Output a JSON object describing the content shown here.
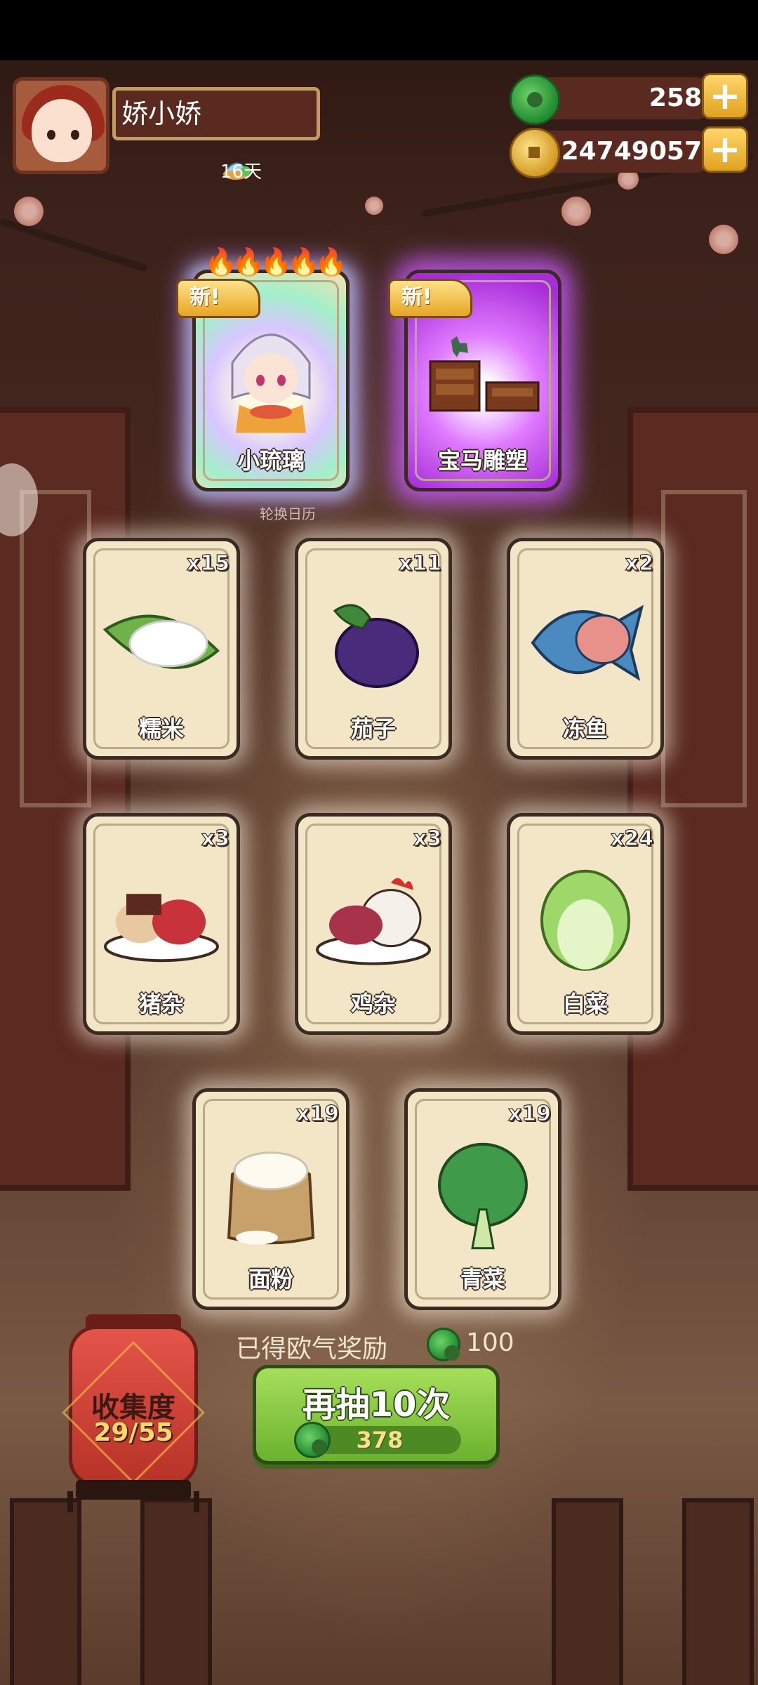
{
  "player": {
    "name": "娇小娇",
    "days": "16天"
  },
  "currency": {
    "jade": "258",
    "coins": "24749057"
  },
  "featured": [
    {
      "badge": "新",
      "label": "小琉璃",
      "stars": "🔥🔥🔥🔥🔥"
    },
    {
      "badge": "新",
      "label": "宝马雕塑"
    }
  ],
  "calendar_hint": "轮换日历",
  "items": [
    {
      "label": "糯米",
      "count": "x15"
    },
    {
      "label": "茄子",
      "count": "x11"
    },
    {
      "label": "冻鱼",
      "count": "x2"
    },
    {
      "label": "猪杂",
      "count": "x3"
    },
    {
      "label": "鸡杂",
      "count": "x3"
    },
    {
      "label": "白菜",
      "count": "x24"
    },
    {
      "label": "面粉",
      "count": "x19"
    },
    {
      "label": "青菜",
      "count": "x19"
    }
  ],
  "collection": {
    "title": "收集度",
    "value": "29/55"
  },
  "reward": {
    "text": "已得欧气奖励",
    "value": "100"
  },
  "draw_button": {
    "label": "再抽10次",
    "cost": "378"
  },
  "colors": {
    "accent_gold": "#e0a21f",
    "jade_green": "#1f8a2e",
    "button_green": "#6bb22e",
    "lantern_red": "#b73227"
  }
}
